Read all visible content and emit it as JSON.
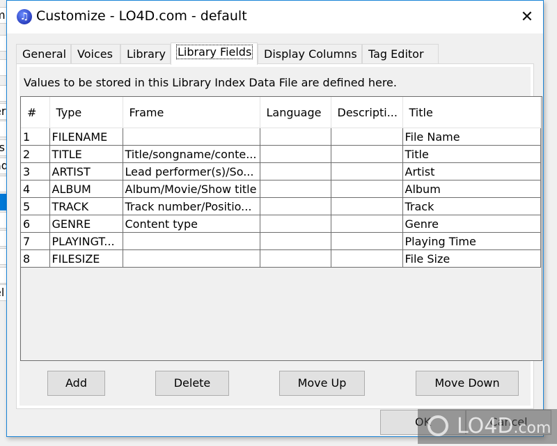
{
  "background_window": {
    "partial_labels": [
      "m",
      "",
      "",
      "",
      "s",
      "er",
      "",
      "rs",
      "ad",
      "",
      "",
      "",
      "",
      "",
      "li",
      "el"
    ]
  },
  "dialog": {
    "title": "Customize - LO4D.com - default",
    "icon": "music-note-icon",
    "close_glyph": "✕"
  },
  "tabs": [
    {
      "label": "General",
      "active": false
    },
    {
      "label": "Voices",
      "active": false
    },
    {
      "label": "Library",
      "active": false
    },
    {
      "label": "Library Fields",
      "active": true
    },
    {
      "label": "Display Columns",
      "active": false
    },
    {
      "label": "Tag Editor",
      "active": false
    }
  ],
  "panel": {
    "description": "Values to be stored in this Library Index Data File are defined here."
  },
  "table": {
    "columns": [
      "#",
      "Type",
      "Frame",
      "Language",
      "Descripti...",
      "Title"
    ],
    "rows": [
      [
        "1",
        "FILENAME",
        "",
        "",
        "",
        "File Name"
      ],
      [
        "2",
        "TITLE",
        "Title/songname/conte...",
        "",
        "",
        "Title"
      ],
      [
        "3",
        "ARTIST",
        "Lead performer(s)/So...",
        "",
        "",
        "Artist"
      ],
      [
        "4",
        "ALBUM",
        "Album/Movie/Show title",
        "",
        "",
        "Album"
      ],
      [
        "5",
        "TRACK",
        "Track number/Positio...",
        "",
        "",
        "Track"
      ],
      [
        "6",
        "GENRE",
        "Content type",
        "",
        "",
        "Genre"
      ],
      [
        "7",
        "PLAYINGT...",
        "",
        "",
        "",
        "Playing Time"
      ],
      [
        "8",
        "FILESIZE",
        "",
        "",
        "",
        "File Size"
      ]
    ]
  },
  "buttons": {
    "add": "Add",
    "delete": "Delete",
    "move_up": "Move Up",
    "move_down": "Move Down",
    "ok": "OK",
    "cancel": "Cancel"
  },
  "watermark": {
    "text": "LO4D",
    "suffix": ".com"
  }
}
